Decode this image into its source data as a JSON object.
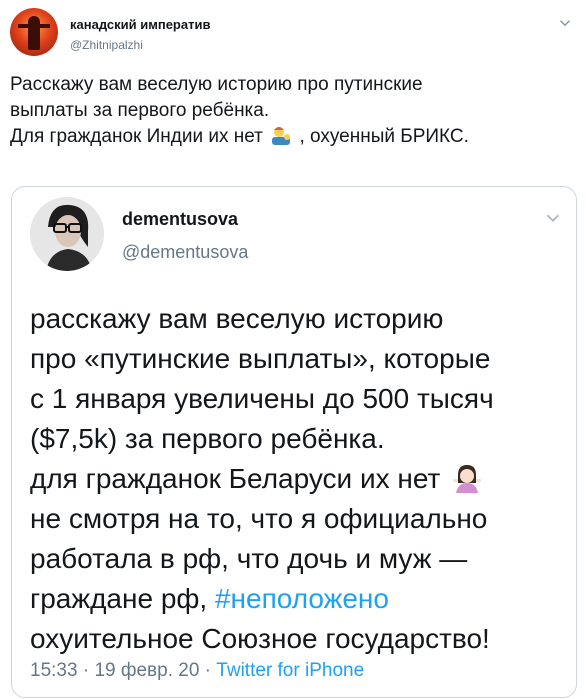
{
  "tweet": {
    "author_name": "канадский императив",
    "author_handle": "@Zhitnipalzhi",
    "text_line1": "Расскажу вам веселую историю про путинские",
    "text_line2": "выплаты за первого ребёнка.",
    "text_line3a": "Для гражданок Индии их нет",
    "text_line3b": ", охуенный БРИКС.",
    "emoji_icon": "man-tipping-hand-emoji"
  },
  "quoted": {
    "author_name": "dementusova",
    "author_handle": "@dementusova",
    "lines": [
      "расскажу вам веселую историю",
      "про «путинские выплаты», которые",
      "с 1 января увеличены до 500 тысяч",
      "($7,5k) за первого ребёнка."
    ],
    "line5": "для гражданок Беларуси их нет",
    "line6": "не смотря на то, что я официально",
    "line7": "работала в рф, что дочь и муж —",
    "line8_prefix": "граждане рф, ",
    "hashtag": "#неположено",
    "line9": "охуительное Союзное государство!",
    "time": "15:33",
    "sep1": " · ",
    "date": "19 февр. 20",
    "sep2": " · ",
    "source": "Twitter for iPhone",
    "emoji_icon": "woman-shrugging-emoji"
  },
  "colors": {
    "text": "#14171a",
    "secondary": "#657786",
    "link": "#1da1f2",
    "border": "#ccd6dd"
  }
}
